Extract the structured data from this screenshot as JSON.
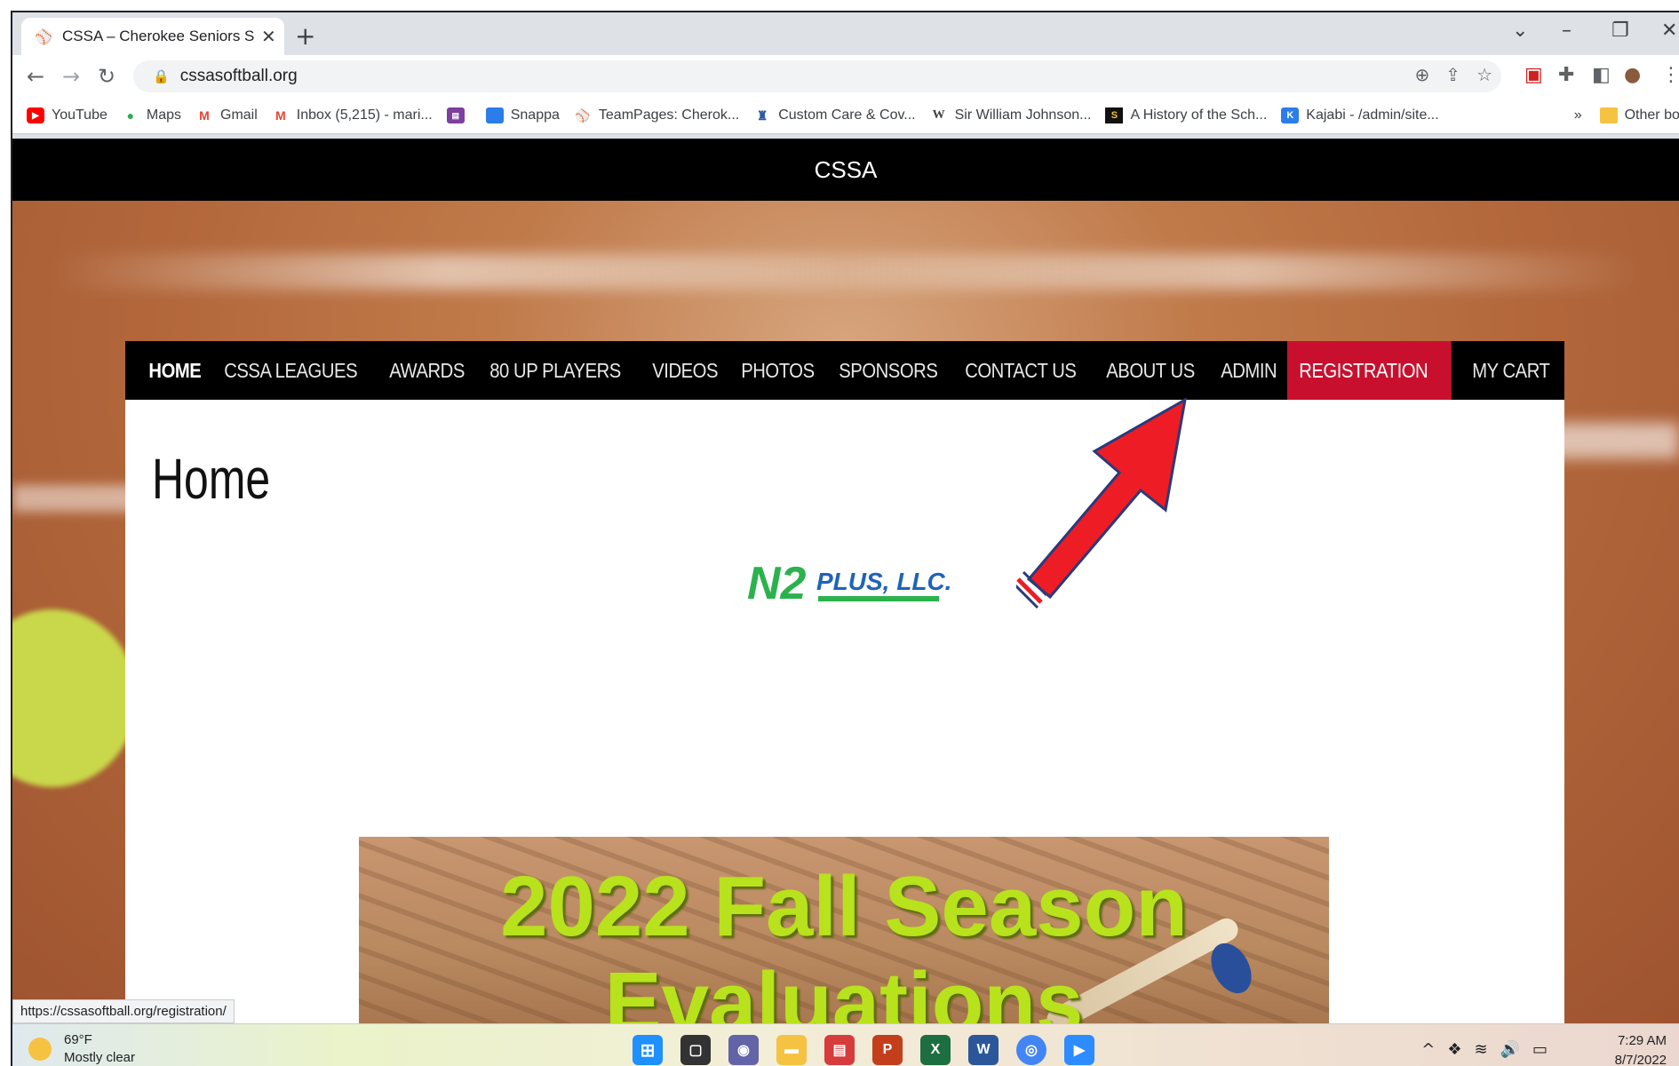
{
  "browser": {
    "tab_title": "CSSA – Cherokee Seniors Softbal",
    "url": "cssasoftball.org",
    "status_url": "https://cssasoftball.org/registration/",
    "bookmarks": [
      {
        "label": "YouTube",
        "icon": "youtube-icon",
        "color": "#ff0000"
      },
      {
        "label": "Maps",
        "icon": "maps-pin-icon",
        "color": "#34a853"
      },
      {
        "label": "Gmail",
        "icon": "gmail-icon",
        "color": "#ea4335"
      },
      {
        "label": "Inbox (5,215) - mari...",
        "icon": "gmail-icon",
        "color": "#ea4335"
      },
      {
        "label": "",
        "icon": "app-icon",
        "color": "#7b3fa0"
      },
      {
        "label": "Snappa",
        "icon": "snappa-icon",
        "color": "#2b7de9"
      },
      {
        "label": "TeamPages: Cherok...",
        "icon": "teampages-icon",
        "color": "#666666"
      },
      {
        "label": "Custom Care & Cov...",
        "icon": "castle-icon",
        "color": "#2c5aa0"
      },
      {
        "label": "Sir William Johnson...",
        "icon": "wikipedia-icon",
        "color": "#000000"
      },
      {
        "label": "A History of the Sch...",
        "icon": "s-icon",
        "color": "#000000"
      },
      {
        "label": "Kajabi - /admin/site...",
        "icon": "kajabi-icon",
        "color": "#2b7de9"
      }
    ],
    "more_bookmarks": "»",
    "other_bookmarks": "Other bookmarks"
  },
  "site": {
    "brand": "CSSA",
    "nav": [
      "HOME",
      "CSSA LEAGUES",
      "AWARDS",
      "80 UP PLAYERS",
      "VIDEOS",
      "PHOTOS",
      "SPONSORS",
      "CONTACT US",
      "ABOUT US",
      "ADMIN",
      "REGISTRATION",
      "MY CART"
    ],
    "page_title": "Home",
    "logo_text_n2": "N2",
    "logo_text_plus": "PLUS, LLC.",
    "banner_line1": "2022 Fall Season",
    "banner_line2": "Evaluations",
    "accent_color": "#c8102e"
  },
  "taskbar": {
    "temp": "69°F",
    "condition": "Mostly clear",
    "time": "7:29 AM",
    "date": "8/7/2022"
  }
}
